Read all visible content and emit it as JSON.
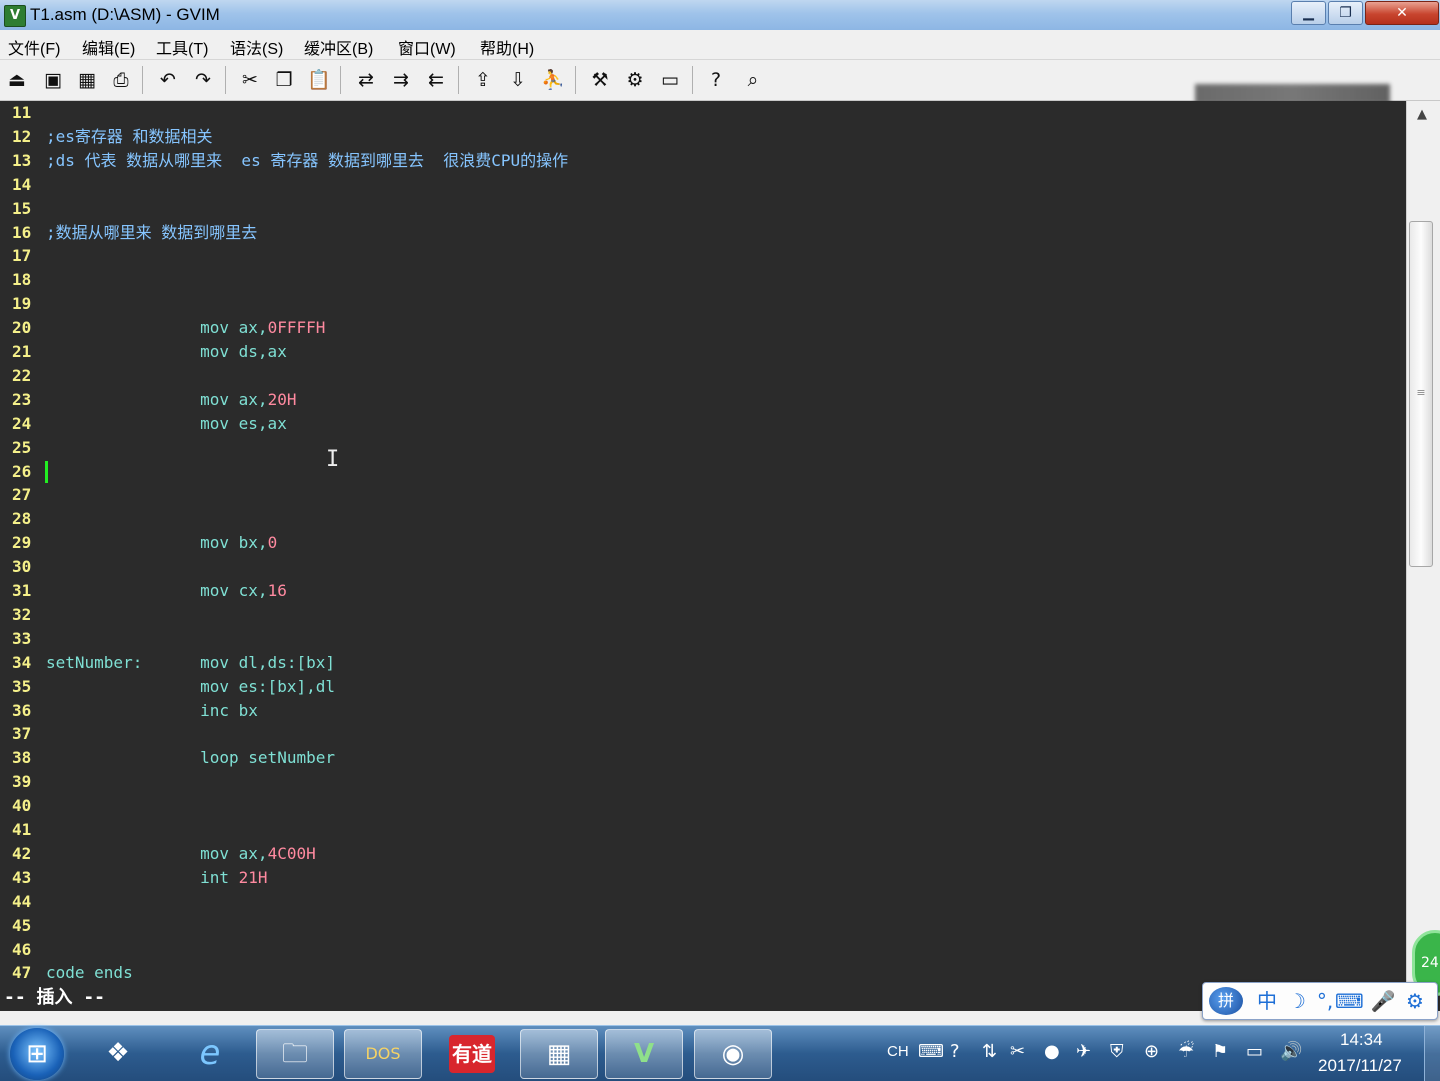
{
  "window": {
    "title": "T1.asm (D:\\ASM) - GVIM",
    "app_icon": "vim-icon",
    "controls": {
      "minimize": "▁",
      "maximize": "❐",
      "close": "✕"
    }
  },
  "menu": [
    {
      "label": "文件(F)"
    },
    {
      "label": "编辑(E)"
    },
    {
      "label": "工具(T)"
    },
    {
      "label": "语法(S)"
    },
    {
      "label": "缓冲区(B)"
    },
    {
      "label": "窗口(W)"
    },
    {
      "label": "帮助(H)"
    }
  ],
  "toolbar": [
    {
      "icon": "open-icon",
      "glyph": "⏏"
    },
    {
      "icon": "save-icon",
      "glyph": "▣"
    },
    {
      "icon": "save-all-icon",
      "glyph": "▦"
    },
    {
      "icon": "print-icon",
      "glyph": "⎙"
    },
    {
      "icon": "undo-icon",
      "glyph": "↶"
    },
    {
      "icon": "redo-icon",
      "glyph": "↷"
    },
    {
      "icon": "cut-icon",
      "glyph": "✂"
    },
    {
      "icon": "copy-icon",
      "glyph": "❐"
    },
    {
      "icon": "paste-icon",
      "glyph": "📋"
    },
    {
      "icon": "replace-icon",
      "glyph": "⇄"
    },
    {
      "icon": "find-next-icon",
      "glyph": "⇉"
    },
    {
      "icon": "find-prev-icon",
      "glyph": "⇇"
    },
    {
      "icon": "load-session-icon",
      "glyph": "⇪"
    },
    {
      "icon": "save-session-icon",
      "glyph": "⇩"
    },
    {
      "icon": "run-script-icon",
      "glyph": "⛹"
    },
    {
      "icon": "make-icon",
      "glyph": "⚒"
    },
    {
      "icon": "shell-icon",
      "glyph": "⚙"
    },
    {
      "icon": "tag-icon",
      "glyph": "▭"
    },
    {
      "icon": "help-icon",
      "glyph": "?"
    },
    {
      "icon": "find-help-icon",
      "glyph": "⌕"
    }
  ],
  "editor": {
    "lines": [
      {
        "n": "11",
        "tokens": []
      },
      {
        "n": "12",
        "tokens": [
          {
            "t": ";es寄存器 和数据相关",
            "c": "comment"
          }
        ]
      },
      {
        "n": "13",
        "tokens": [
          {
            "t": ";ds 代表 数据从哪里来  es 寄存器 数据到哪里去  很浪费CPU的操作",
            "c": "comment"
          }
        ]
      },
      {
        "n": "14",
        "tokens": []
      },
      {
        "n": "15",
        "tokens": []
      },
      {
        "n": "16",
        "tokens": [
          {
            "t": ";数据从哪里来 数据到哪里去",
            "c": "comment"
          }
        ]
      },
      {
        "n": "17",
        "tokens": []
      },
      {
        "n": "18",
        "tokens": []
      },
      {
        "n": "19",
        "tokens": []
      },
      {
        "n": "20",
        "tokens": [
          {
            "t": "                mov ax,",
            "c": "kw"
          },
          {
            "t": "0FFFFH",
            "c": "num"
          }
        ]
      },
      {
        "n": "21",
        "tokens": [
          {
            "t": "                mov ds,ax",
            "c": "kw"
          }
        ]
      },
      {
        "n": "22",
        "tokens": []
      },
      {
        "n": "23",
        "tokens": [
          {
            "t": "                mov ax,",
            "c": "kw"
          },
          {
            "t": "20H",
            "c": "num"
          }
        ]
      },
      {
        "n": "24",
        "tokens": [
          {
            "t": "                mov es,ax",
            "c": "kw"
          }
        ]
      },
      {
        "n": "25",
        "tokens": []
      },
      {
        "n": "26",
        "tokens": []
      },
      {
        "n": "27",
        "tokens": []
      },
      {
        "n": "28",
        "tokens": []
      },
      {
        "n": "29",
        "tokens": [
          {
            "t": "                mov bx,",
            "c": "kw"
          },
          {
            "t": "0",
            "c": "num"
          }
        ]
      },
      {
        "n": "30",
        "tokens": []
      },
      {
        "n": "31",
        "tokens": [
          {
            "t": "                mov cx,",
            "c": "kw"
          },
          {
            "t": "16",
            "c": "num"
          }
        ]
      },
      {
        "n": "32",
        "tokens": []
      },
      {
        "n": "33",
        "tokens": []
      },
      {
        "n": "34",
        "tokens": [
          {
            "t": "setNumber:      ",
            "c": "label"
          },
          {
            "t": "mov dl,ds:[bx]",
            "c": "kw"
          }
        ]
      },
      {
        "n": "35",
        "tokens": [
          {
            "t": "                mov es:[bx],dl",
            "c": "kw"
          }
        ]
      },
      {
        "n": "36",
        "tokens": [
          {
            "t": "                inc bx",
            "c": "kw"
          }
        ]
      },
      {
        "n": "37",
        "tokens": []
      },
      {
        "n": "38",
        "tokens": [
          {
            "t": "                loop setNumber",
            "c": "kw"
          }
        ]
      },
      {
        "n": "39",
        "tokens": []
      },
      {
        "n": "40",
        "tokens": []
      },
      {
        "n": "41",
        "tokens": []
      },
      {
        "n": "42",
        "tokens": [
          {
            "t": "                mov ax,",
            "c": "kw"
          },
          {
            "t": "4C00H",
            "c": "num"
          }
        ]
      },
      {
        "n": "43",
        "tokens": [
          {
            "t": "                int ",
            "c": "kw"
          },
          {
            "t": "21H",
            "c": "num"
          }
        ]
      },
      {
        "n": "44",
        "tokens": []
      },
      {
        "n": "45",
        "tokens": []
      },
      {
        "n": "46",
        "tokens": []
      },
      {
        "n": "47",
        "tokens": [
          {
            "t": "code ends",
            "c": "kw"
          }
        ]
      }
    ],
    "cursor_line": "26",
    "mode_text": "-- 插入 --"
  },
  "ime": {
    "logo": "拼",
    "items": [
      "中",
      "☽",
      "°,",
      "⌨",
      "🎤",
      "⚙"
    ]
  },
  "green_badge": "24",
  "taskbar": {
    "start_glyph": "⊞",
    "apps": [
      {
        "name": "taskbar-app-colorful",
        "glyph": "❖",
        "active": false
      },
      {
        "name": "taskbar-app-ie",
        "glyph": "e",
        "active": false
      },
      {
        "name": "taskbar-app-explorer",
        "glyph": "🗀",
        "active": true
      },
      {
        "name": "taskbar-app-dosbox",
        "glyph": "DOS",
        "active": true
      },
      {
        "name": "taskbar-app-youdao",
        "glyph": "有道",
        "active": false
      },
      {
        "name": "taskbar-app-calculator",
        "glyph": "▦",
        "active": true
      },
      {
        "name": "taskbar-app-gvim",
        "glyph": "V",
        "active": true
      },
      {
        "name": "taskbar-app-obs",
        "glyph": "◉",
        "active": true
      }
    ],
    "tray": {
      "lang": "CH",
      "icons": [
        "⌨",
        "?",
        "⇅",
        "✂",
        "●",
        "✈",
        "⛨",
        "⊕",
        "☔",
        "⚑",
        "▭",
        "🔊"
      ]
    },
    "clock": {
      "time": "14:34",
      "date": "2017/11/27"
    }
  }
}
